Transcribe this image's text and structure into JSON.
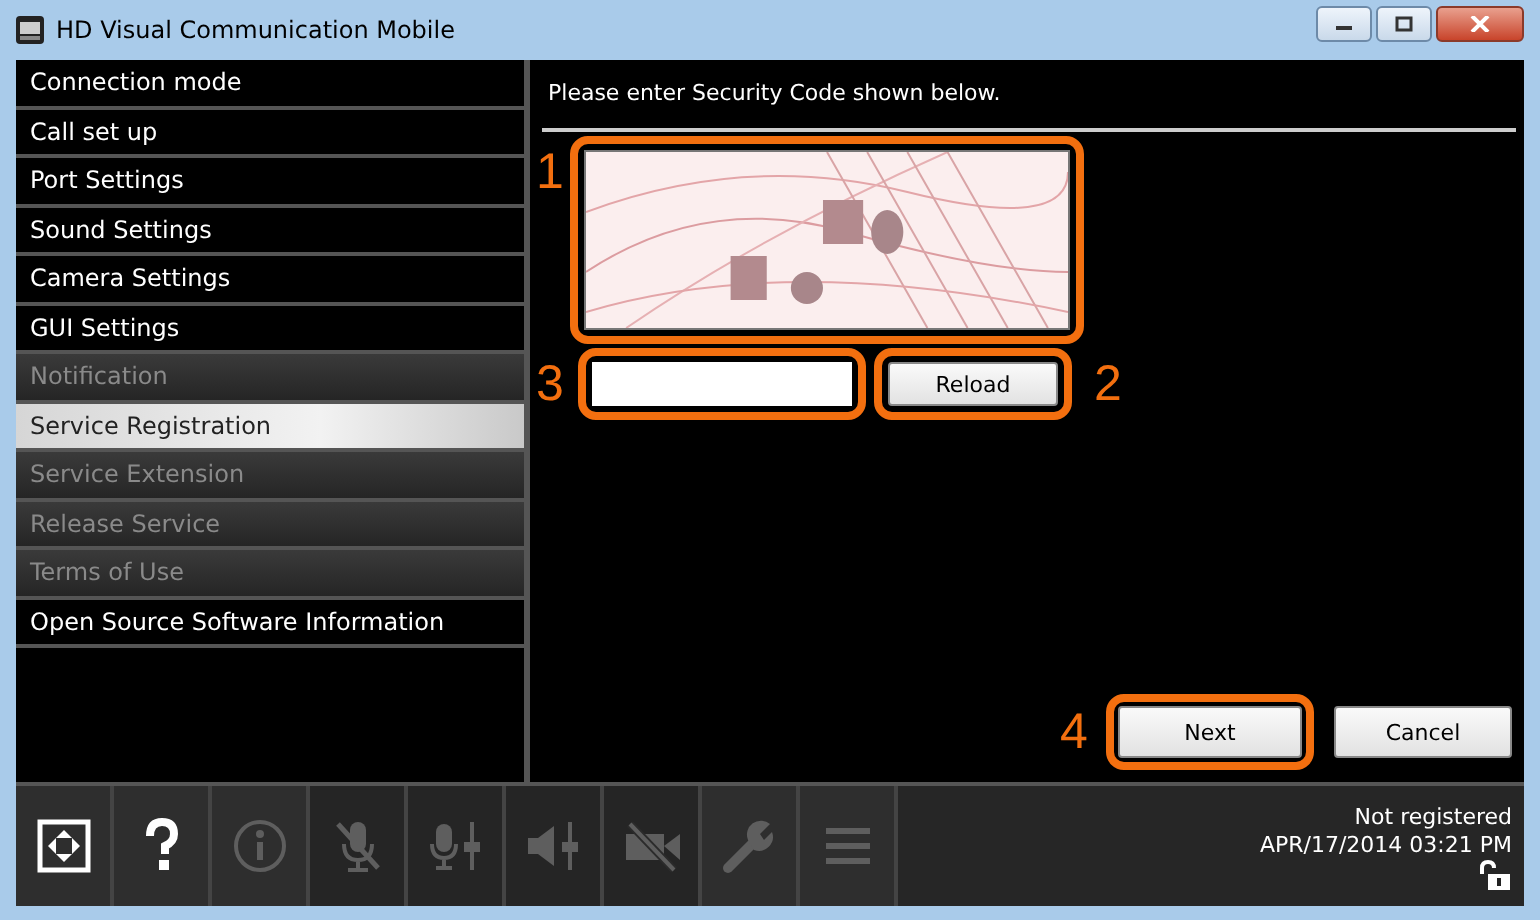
{
  "window": {
    "title": "HD Visual Communication Mobile"
  },
  "menu": [
    {
      "label": "Connection mode",
      "selected": false,
      "disabled": false
    },
    {
      "label": "Call set up",
      "selected": false,
      "disabled": false
    },
    {
      "label": "Port Settings",
      "selected": false,
      "disabled": false
    },
    {
      "label": "Sound Settings",
      "selected": false,
      "disabled": false
    },
    {
      "label": "Camera Settings",
      "selected": false,
      "disabled": false
    },
    {
      "label": "GUI Settings",
      "selected": false,
      "disabled": false
    },
    {
      "label": "Notification",
      "selected": false,
      "disabled": true
    },
    {
      "label": "Service Registration",
      "selected": true,
      "disabled": false
    },
    {
      "label": "Service Extension",
      "selected": false,
      "disabled": true
    },
    {
      "label": "Release Service",
      "selected": false,
      "disabled": true
    },
    {
      "label": "Terms of Use",
      "selected": false,
      "disabled": true
    },
    {
      "label": "Open Source Software Information",
      "selected": false,
      "disabled": false
    }
  ],
  "prompt": "Please enter Security Code shown below.",
  "buttons": {
    "reload": "Reload",
    "next": "Next",
    "cancel": "Cancel"
  },
  "callouts": [
    "1",
    "3",
    "2",
    "4"
  ],
  "toolbar": [
    {
      "kind": "fullscreen",
      "disabled": false
    },
    {
      "kind": "help",
      "disabled": false
    },
    {
      "kind": "info",
      "disabled": true
    },
    {
      "kind": "mic-mute",
      "disabled": true
    },
    {
      "kind": "mic-level",
      "disabled": true
    },
    {
      "kind": "speaker-level",
      "disabled": true
    },
    {
      "kind": "camera-off",
      "disabled": true
    },
    {
      "kind": "wrench",
      "disabled": true
    },
    {
      "kind": "menu",
      "disabled": true
    }
  ],
  "status": {
    "registration": "Not registered",
    "datetime": "APR/17/2014 03:21 PM"
  }
}
